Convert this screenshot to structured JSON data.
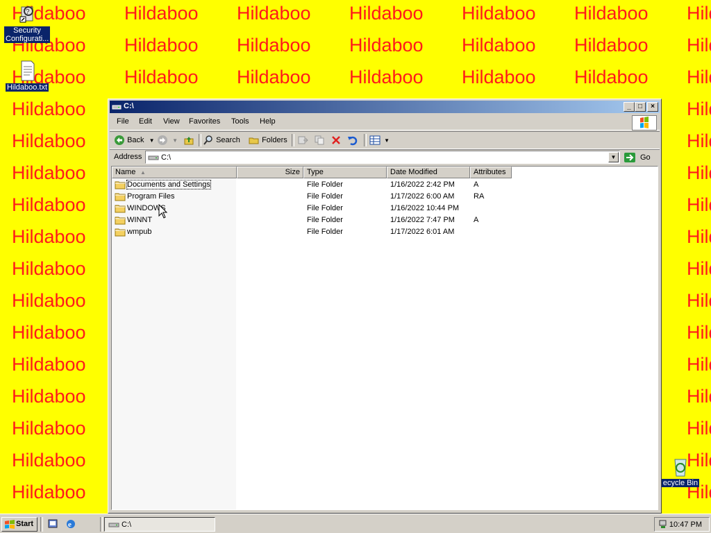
{
  "wallpaper": {
    "word": "Hildaboo",
    "color": "#ff1a1a",
    "background": "#ffff00"
  },
  "desktop": {
    "icons": [
      {
        "label": "Security Configurati...",
        "icon": "security-config-icon"
      },
      {
        "label": "Hildaboo.txt",
        "icon": "text-file-icon"
      },
      {
        "label": "ecycle Bin",
        "icon": "recycle-bin-icon"
      }
    ]
  },
  "window": {
    "title": "C:\\",
    "menu": [
      "File",
      "Edit",
      "View",
      "Favorites",
      "Tools",
      "Help"
    ],
    "toolbar": {
      "back": "Back",
      "search": "Search",
      "folders": "Folders"
    },
    "address": {
      "label": "Address",
      "value": "C:\\",
      "go": "Go"
    },
    "columns": [
      "Name",
      "Size",
      "Type",
      "Date Modified",
      "Attributes"
    ],
    "rows": [
      {
        "name": "Documents and Settings",
        "size": "",
        "type": "File Folder",
        "modified": "1/16/2022 2:42 PM",
        "attributes": "A"
      },
      {
        "name": "Program Files",
        "size": "",
        "type": "File Folder",
        "modified": "1/17/2022 6:00 AM",
        "attributes": "RA"
      },
      {
        "name": "WINDOWS",
        "size": "",
        "type": "File Folder",
        "modified": "1/16/2022 10:44 PM",
        "attributes": ""
      },
      {
        "name": "WINNT",
        "size": "",
        "type": "File Folder",
        "modified": "1/16/2022 7:47 PM",
        "attributes": "A"
      },
      {
        "name": "wmpub",
        "size": "",
        "type": "File Folder",
        "modified": "1/17/2022 6:01 AM",
        "attributes": ""
      }
    ]
  },
  "taskbar": {
    "start": "Start",
    "task": "C:\\",
    "clock": "10:47 PM"
  }
}
